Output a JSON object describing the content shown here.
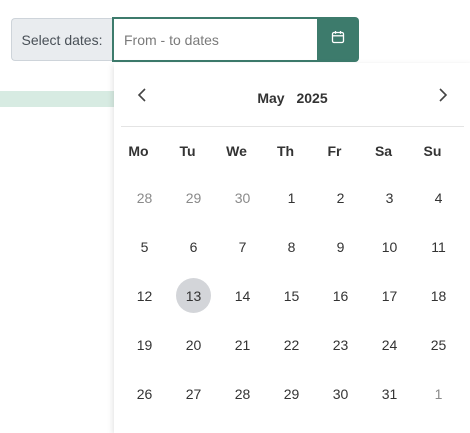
{
  "picker": {
    "label": "Select dates:",
    "input_placeholder": "From - to dates",
    "input_value": "",
    "button_icon": "calendar-icon",
    "accent_color": "#3d7b6c"
  },
  "calendar": {
    "month": "May",
    "year": "2025",
    "prev_icon": "chevron-left-icon",
    "next_icon": "chevron-right-icon",
    "weekdays": [
      "Mo",
      "Tu",
      "We",
      "Th",
      "Fr",
      "Sa",
      "Su"
    ],
    "highlighted_day": "13",
    "days": [
      {
        "label": "28",
        "muted": true
      },
      {
        "label": "29",
        "muted": true
      },
      {
        "label": "30",
        "muted": true
      },
      {
        "label": "1"
      },
      {
        "label": "2"
      },
      {
        "label": "3"
      },
      {
        "label": "4"
      },
      {
        "label": "5"
      },
      {
        "label": "6"
      },
      {
        "label": "7"
      },
      {
        "label": "8"
      },
      {
        "label": "9"
      },
      {
        "label": "10"
      },
      {
        "label": "11"
      },
      {
        "label": "12"
      },
      {
        "label": "13",
        "today": true
      },
      {
        "label": "14"
      },
      {
        "label": "15"
      },
      {
        "label": "16"
      },
      {
        "label": "17"
      },
      {
        "label": "18"
      },
      {
        "label": "19"
      },
      {
        "label": "20"
      },
      {
        "label": "21"
      },
      {
        "label": "22"
      },
      {
        "label": "23"
      },
      {
        "label": "24"
      },
      {
        "label": "25"
      },
      {
        "label": "26"
      },
      {
        "label": "27"
      },
      {
        "label": "28"
      },
      {
        "label": "29"
      },
      {
        "label": "30"
      },
      {
        "label": "31"
      },
      {
        "label": "1",
        "muted": true
      }
    ]
  }
}
